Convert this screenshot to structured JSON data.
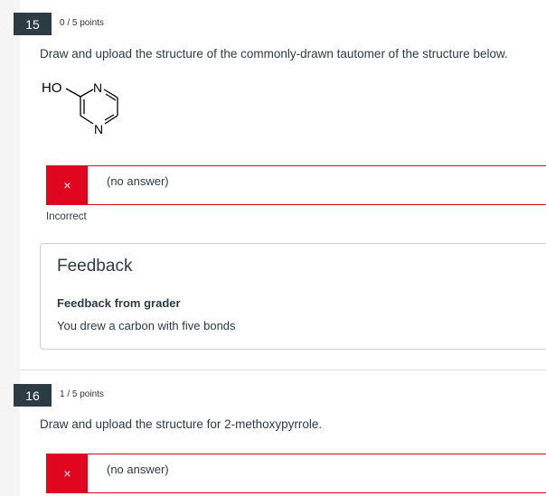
{
  "q15": {
    "number": "15",
    "points": "0 / 5 points",
    "prompt": "Draw and upload the structure of the commonly-drawn tautomer of the structure below.",
    "structure": {
      "ho_label": "HO",
      "n_top_label": "N",
      "n_bottom_label": "N"
    },
    "answer_icon": "×",
    "answer_text": "(no answer)",
    "status": "Incorrect",
    "feedback": {
      "heading": "Feedback",
      "from_label": "Feedback from grader",
      "text": "You drew a carbon with five bonds"
    }
  },
  "q16": {
    "number": "16",
    "points": "1 / 5 points",
    "prompt": "Draw and upload the structure for 2-methoxypyrrole.",
    "answer_icon": "×",
    "answer_text": "(no answer)"
  },
  "colors": {
    "badge_bg": "#2d3b45",
    "incorrect_red": "#e0061f",
    "text": "#2d3b45"
  }
}
